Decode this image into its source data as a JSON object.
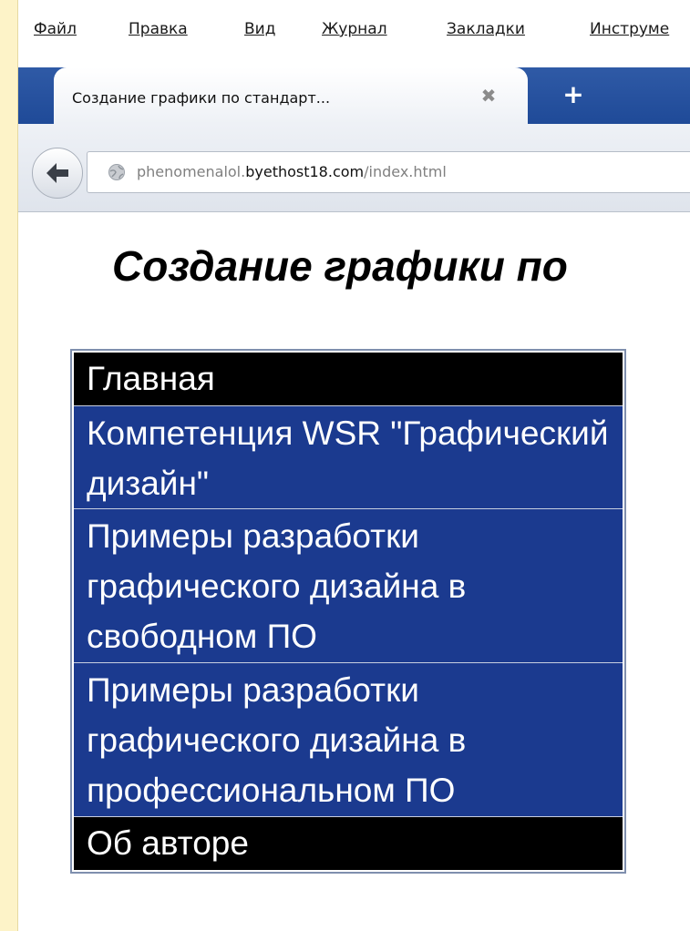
{
  "menu": {
    "items": [
      "Файл",
      "Правка",
      "Вид",
      "Журнал",
      "Закладки",
      "Инструме"
    ]
  },
  "tab": {
    "title": "Создание графики по стандарт...",
    "close_glyph": "✖",
    "new_tab_glyph": "+"
  },
  "address": {
    "prefix": "phenomenalol.",
    "host": "byethost18.com",
    "path": "/index.html"
  },
  "page": {
    "title": "Создание графики по",
    "nav": [
      {
        "label": "Главная",
        "style": "dark"
      },
      {
        "label": "Компетенция WSR \"Графический дизайн\"",
        "style": "blue"
      },
      {
        "label": "Примеры разработки графического дизайна в свободном ПО",
        "style": "blue"
      },
      {
        "label": "Примеры разработки графического дизайна в профессиональном ПО",
        "style": "blue"
      },
      {
        "label": "Об авторе",
        "style": "dark"
      }
    ]
  },
  "colors": {
    "tabstrip": "#1f4a98",
    "nav_blue": "#1b3a8f",
    "nav_dark": "#000000",
    "left_strip": "#fdf3c8"
  }
}
